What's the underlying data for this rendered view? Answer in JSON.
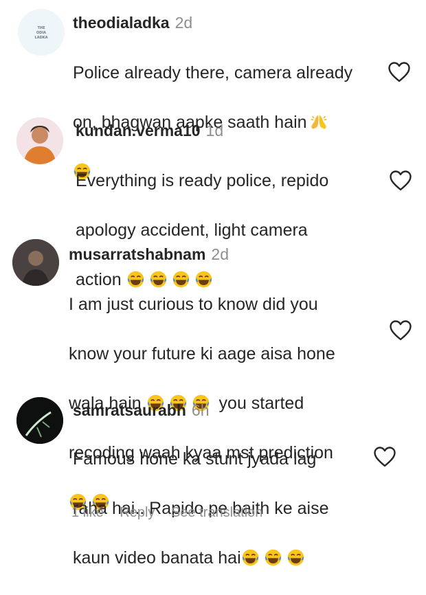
{
  "comments": [
    {
      "username": "theodialadka",
      "time": "2d",
      "lines": [
        "Police already there, camera already",
        "on, bhagwan aapke saath hain"
      ],
      "avatar_logo": "THE ODIA LADKA"
    },
    {
      "username": "kundan.verma10",
      "time": "1d",
      "lines": [
        "Everything is ready police, repido",
        "apology accident, light camera",
        "action"
      ]
    },
    {
      "username": "musarratshabnam",
      "time": "2d",
      "lines": [
        "I am just curious to know did you",
        "know your future ki aage aisa hone",
        "wala hain",
        "you started",
        "recoding waah kyaa mst prediction"
      ]
    },
    {
      "username": "samratsaurabh",
      "time": "6h",
      "lines": [
        "Famous hone ka stunt jyada lag",
        "raha hai.. Rapido pe baith ke aise",
        "kaun video banata hai"
      ]
    }
  ],
  "actions": {
    "likes": "1 like",
    "reply": "Reply",
    "translate": "See translation"
  },
  "icons": {
    "like": "heart-outline-icon",
    "laugh": "face-with-tears-of-joy-emoji",
    "pray": "folded-hands-emoji"
  },
  "colors": {
    "username": "#262626",
    "secondary": "#8e8e8e",
    "emoji_face": "#f9c41e",
    "emoji_tear": "#3d8ee8"
  }
}
